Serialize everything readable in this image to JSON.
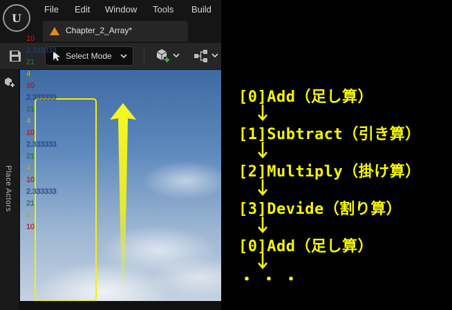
{
  "app": {
    "logo_text": "U"
  },
  "menu": {
    "items": [
      "File",
      "Edit",
      "Window",
      "Tools",
      "Build"
    ]
  },
  "document_tab": {
    "label": "Chapter_2_Array*"
  },
  "toolbar": {
    "select_mode_label": "Select Mode"
  },
  "left_panel": {
    "place_actors_label": "Place Actors"
  },
  "viewport": {
    "log_lines": [
      {
        "text": "10",
        "color": "#d81e1e"
      },
      {
        "text": "2.333333",
        "color": "#2a4aa8"
      },
      {
        "text": "21",
        "color": "#1f8a60"
      },
      {
        "text": "4",
        "color": "#d8d800"
      },
      {
        "text": "10",
        "color": "#d81e1e"
      },
      {
        "text": "2.333333",
        "color": "#2a4aa8"
      },
      {
        "text": "21",
        "color": "#1f8a60"
      },
      {
        "text": "4",
        "color": "#d8d800"
      },
      {
        "text": "10",
        "color": "#d81e1e"
      },
      {
        "text": "2.333333",
        "color": "#2a4aa8"
      },
      {
        "text": "21",
        "color": "#1f8a60"
      },
      {
        "text": "4",
        "color": "#d8d800"
      },
      {
        "text": "10",
        "color": "#d81e1e"
      },
      {
        "text": "2.333333",
        "color": "#2a4aa8"
      },
      {
        "text": "21",
        "color": "#1f8a60"
      },
      {
        "text": "4",
        "color": "#d8d800"
      },
      {
        "text": "10",
        "color": "#d81e1e"
      }
    ]
  },
  "annotation": {
    "steps": [
      "[0]Add（足し算）",
      "[1]Subtract（引き算）",
      "[2]Multiply（掛け算）",
      "[3]Devide（割り算）",
      "[0]Add（足し算）"
    ],
    "ellipsis": "・・・",
    "color": "#f7f700"
  }
}
